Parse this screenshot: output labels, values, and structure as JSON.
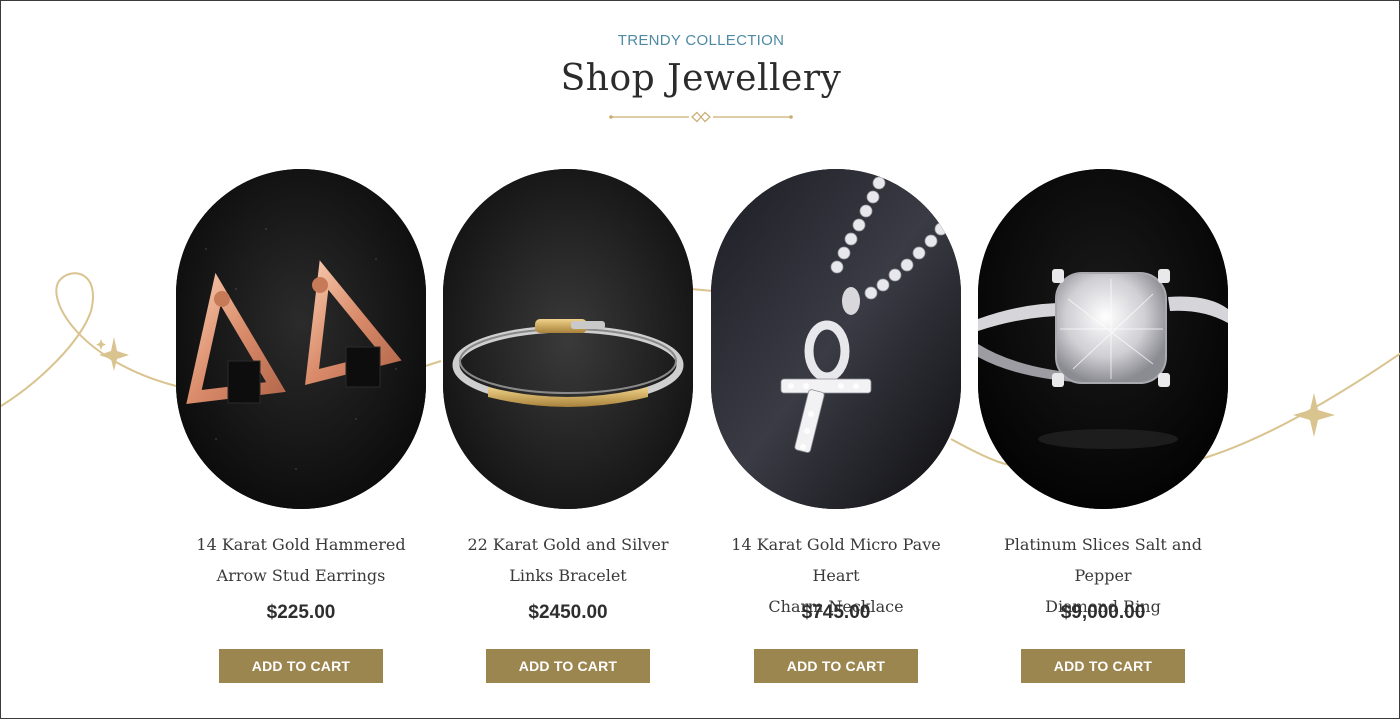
{
  "header": {
    "eyebrow": "TRENDY COLLECTION",
    "title": "Shop Jewellery"
  },
  "colors": {
    "accent_gold": "#9c8650",
    "eyebrow_blue": "#4f8aa3",
    "swirl_gold": "#d9c38f"
  },
  "products": [
    {
      "name_line1": "14 Karat Gold Hammered",
      "name_line2": "Arrow Stud Earrings",
      "price": "$225.00",
      "button": "ADD TO CART",
      "image": "rose-gold-triangle-earrings"
    },
    {
      "name_line1": "22 Karat Gold and Silver",
      "name_line2": "Links Bracelet",
      "price": "$2450.00",
      "button": "ADD TO CART",
      "image": "gold-silver-bracelet"
    },
    {
      "name_line1": "14 Karat Gold Micro Pave Heart",
      "name_line2": "Charm Necklace",
      "price": "$745.00",
      "button": "ADD TO CART",
      "image": "diamond-ankh-necklace"
    },
    {
      "name_line1": "Platinum Slices Salt and Pepper",
      "name_line2": "Diamond Ring",
      "price": "$9,000.00",
      "button": "ADD TO CART",
      "image": "diamond-ring"
    }
  ]
}
